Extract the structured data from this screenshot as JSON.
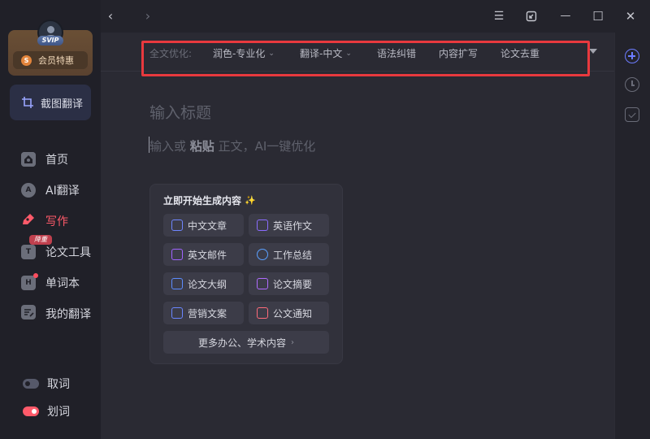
{
  "sidebar": {
    "vip_badge": "SVIP",
    "member_button": "会员特惠",
    "member_coin": "S",
    "capture_button": "截图翻译",
    "nav": [
      {
        "id": "home",
        "label": "首页",
        "icon": "home-icon"
      },
      {
        "id": "ai-translate",
        "label": "AI翻译",
        "icon": "ai-icon",
        "icon_glyph": "A"
      },
      {
        "id": "write",
        "label": "写作",
        "icon": "pen-icon",
        "active": true
      },
      {
        "id": "paper-tools",
        "label": "论文工具",
        "icon": "paper-icon",
        "icon_glyph": "T",
        "badge": "降重"
      },
      {
        "id": "vocab",
        "label": "单词本",
        "icon": "book-icon",
        "icon_glyph": "H",
        "dot": true
      },
      {
        "id": "my-translations",
        "label": "我的翻译",
        "icon": "list-icon"
      }
    ],
    "toggles": [
      {
        "label": "取词",
        "on": false
      },
      {
        "label": "划词",
        "on": true
      }
    ]
  },
  "titlebar": {
    "back_icon": "‹",
    "forward_icon": "›",
    "menu_icon": "☰",
    "minimize_icon": "—",
    "maximize_icon": "☐",
    "close_icon": "✕"
  },
  "toolbar": {
    "prefix": "全文优化:",
    "items": [
      {
        "label": "润色-专业化",
        "dropdown": true
      },
      {
        "label": "翻译-中文",
        "dropdown": true
      },
      {
        "label": "语法纠错",
        "dropdown": false
      },
      {
        "label": "内容扩写",
        "dropdown": false
      },
      {
        "label": "论文去重",
        "dropdown": false
      }
    ]
  },
  "editor": {
    "title_placeholder": "输入标题",
    "body_placeholder_a": "输入或 ",
    "body_placeholder_bold": "粘贴",
    "body_placeholder_b": " 正文，AI一键优化"
  },
  "generate": {
    "title": "立即开始生成内容",
    "sparkle": "✨",
    "buttons": [
      {
        "label": "中文文章",
        "color": "#6f86ff"
      },
      {
        "label": "英语作文",
        "color": "#8b6cff"
      },
      {
        "label": "英文邮件",
        "color": "#a064ff"
      },
      {
        "label": "工作总结",
        "color": "#5aa0ff"
      },
      {
        "label": "论文大纲",
        "color": "#5c8cff"
      },
      {
        "label": "论文摘要",
        "color": "#b06cff"
      },
      {
        "label": "营销文案",
        "color": "#6a86ff"
      },
      {
        "label": "公文通知",
        "color": "#ff6b7a"
      }
    ],
    "more": "更多办公、学术内容",
    "more_chevron": "›"
  }
}
